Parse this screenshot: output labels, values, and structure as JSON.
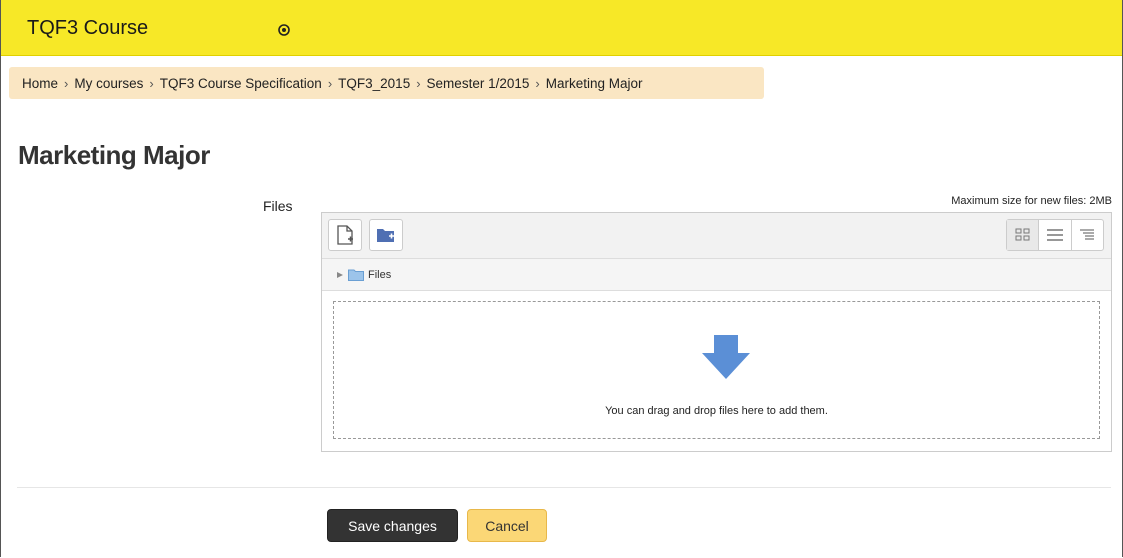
{
  "header": {
    "course_title": "TQF3 Course",
    "dropdown_icon": "circle-down-icon",
    "background_color": "#f7e827"
  },
  "breadcrumb": {
    "items": [
      "Home",
      "My courses",
      "TQF3 Course Specification",
      "TQF3_2015",
      "Semester 1/2015",
      "Marketing Major"
    ],
    "separator": ">"
  },
  "page": {
    "title": "Marketing Major"
  },
  "form": {
    "files_label": "Files",
    "max_size": "Maximum size for new files: 2MB"
  },
  "filemanager": {
    "toolbar": {
      "add_file_icon": "add-file-icon",
      "create_folder_icon": "create-folder-icon",
      "view_icons": [
        "grid-view-icon",
        "list-view-icon",
        "tree-view-icon"
      ]
    },
    "path_label": "Files",
    "drop_text": "You can drag and drop files here to add them.",
    "drop_arrow_color": "#5b8fd6"
  },
  "actions": {
    "save_label": "Save changes",
    "cancel_label": "Cancel"
  }
}
